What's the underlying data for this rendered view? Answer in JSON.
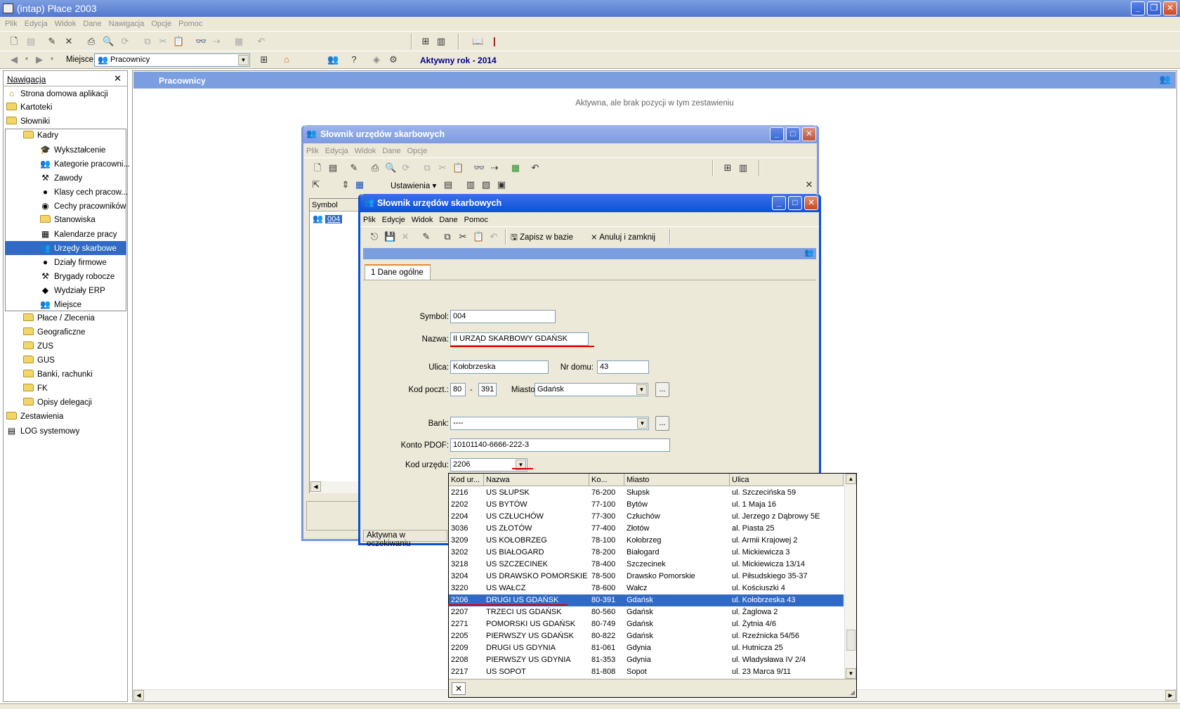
{
  "app": {
    "title": "(intap)  Płace 2003"
  },
  "menu": [
    "Plik",
    "Edycja",
    "Widok",
    "Dane",
    "Nawigacja",
    "Opcje",
    "Pomoc"
  ],
  "toolbar2": {
    "place_label": "Miejsce",
    "place_value": "Pracownicy",
    "active_year": "Aktywny rok - 2014"
  },
  "nav": {
    "header": "Nawigacja",
    "items": [
      {
        "label": "Strona domowa aplikacji",
        "icon": "home-icon"
      },
      {
        "label": "Kartoteki",
        "icon": "folder-icon"
      },
      {
        "label": "Słowniki",
        "icon": "folder-icon"
      },
      {
        "label": "Kadry",
        "icon": "folder-icon"
      },
      {
        "label": "Wykształcenie",
        "icon": "graduate-icon"
      },
      {
        "label": "Kategorie pracowni...",
        "icon": "people-icon"
      },
      {
        "label": "Zawody",
        "icon": "profession-icon"
      },
      {
        "label": "Klasy cech pracow...",
        "icon": "class-icon"
      },
      {
        "label": "Cechy pracowników",
        "icon": "globe-icon"
      },
      {
        "label": "Stanowiska",
        "icon": "folder-icon"
      },
      {
        "label": "Kalendarze pracy",
        "icon": "calendar-icon"
      },
      {
        "label": "Urzędy skarbowe",
        "icon": "tax-office-icon"
      },
      {
        "label": "Działy firmowe",
        "icon": "department-icon"
      },
      {
        "label": "Brygady robocze",
        "icon": "worker-icon"
      },
      {
        "label": "Wydziały ERP",
        "icon": "erp-icon"
      },
      {
        "label": "Miejsce",
        "icon": "place-icon"
      },
      {
        "label": "Płace / Zlecenia",
        "icon": "folder-icon"
      },
      {
        "label": "Geograficzne",
        "icon": "folder-icon"
      },
      {
        "label": "ZUS",
        "icon": "folder-icon"
      },
      {
        "label": "GUS",
        "icon": "folder-icon"
      },
      {
        "label": "Banki, rachunki",
        "icon": "folder-icon"
      },
      {
        "label": "FK",
        "icon": "folder-icon"
      },
      {
        "label": "Opisy delegacji",
        "icon": "folder-icon"
      },
      {
        "label": "Zestawienia",
        "icon": "folder-icon"
      },
      {
        "label": "LOG systemowy",
        "icon": "log-icon"
      }
    ]
  },
  "main": {
    "title": "Pracownicy",
    "empty_message": "Aktywna, ale brak pozycji w tym zestawieniu"
  },
  "list_window": {
    "title": "Słownik urzędów skarbowych",
    "menu": [
      "Plik",
      "Edycja",
      "Widok",
      "Dane",
      "Opcje"
    ],
    "settings_label": "Ustawienia",
    "column": "Symbol",
    "row_value": "004"
  },
  "edit_window": {
    "title": "Słownik urzędów skarbowych",
    "menu": [
      "Plik",
      "Edycje",
      "Widok",
      "Dane",
      "Pomoc"
    ],
    "save_label": "Zapisz w bazie",
    "cancel_label": "Anuluj i zamknij",
    "tab": "1 Dane ogólne",
    "status": "Aktywna w oczekiwaniu",
    "fields": {
      "symbol_label": "Symbol:",
      "symbol": "004",
      "name_label": "Nazwa:",
      "name": "II  URZĄD SKARBOWY GDAŃSK",
      "street_label": "Ulica:",
      "street": "Kołobrzeska",
      "house_label": "Nr domu:",
      "house": "43",
      "postal_label": "Kod poczt.:",
      "postal1": "80",
      "postal_dash": "-",
      "postal2": "391",
      "city_label": "Miasto:",
      "city": "Gdańsk",
      "bank_label": "Bank:",
      "bank": "----",
      "account_label": "Konto PDOF:",
      "account": "10101140-6666-222-3",
      "office_label": "Kod urzędu:",
      "office": "2206",
      "ellipsis": "..."
    }
  },
  "dropdown": {
    "columns": [
      "Kod ur...",
      "Nazwa",
      "Ko...",
      "Miasto",
      "Ulica"
    ],
    "rows": [
      [
        "2216",
        "US SŁUPSK",
        "76-200",
        "Słupsk",
        "ul. Szczecińska 59"
      ],
      [
        "2202",
        "US BYTÓW",
        "77-100",
        "Bytów",
        "ul. 1 Maja 16"
      ],
      [
        "2204",
        "US CZŁUCHÓW",
        "77-300",
        "Człuchów",
        "ul. Jerzego z Dąbrowy 5E"
      ],
      [
        "3036",
        "US ZŁOTÓW",
        "77-400",
        "Złotów",
        "al. Piasta 25"
      ],
      [
        "3209",
        "US KOŁOBRZEG",
        "78-100",
        "Kołobrzeg",
        "ul. Armii Krajowej 2"
      ],
      [
        "3202",
        "US BIAŁOGARD",
        "78-200",
        "Białogard",
        "ul. Mickiewicza 3"
      ],
      [
        "3218",
        "US SZCZECINEK",
        "78-400",
        "Szczecinek",
        "ul. Mickiewicza 13/14"
      ],
      [
        "3204",
        "US DRAWSKO POMORSKIE",
        "78-500",
        "Drawsko Pomorskie",
        "ul. Piłsudskiego 35-37"
      ],
      [
        "3220",
        "US WAŁCZ",
        "78-600",
        "Wałcz",
        "ul. Kościuszki 4"
      ],
      [
        "2206",
        "DRUGI US GDAŃSK",
        "80-391",
        "Gdańsk",
        "ul. Kołobrzeska 43"
      ],
      [
        "2207",
        "TRZECI US GDAŃSK",
        "80-560",
        "Gdańsk",
        "ul. Żaglowa 2"
      ],
      [
        "2271",
        "POMORSKI US GDAŃSK",
        "80-749",
        "Gdańsk",
        "ul. Żytnia 4/6"
      ],
      [
        "2205",
        "PIERWSZY US GDAŃSK",
        "80-822",
        "Gdańsk",
        "ul. Rzeźnicka 54/56"
      ],
      [
        "2209",
        "DRUGI US GDYNIA",
        "81-061",
        "Gdynia",
        "ul. Hutnicza 25"
      ],
      [
        "2208",
        "PIERWSZY US GDYNIA",
        "81-353",
        "Gdynia",
        "ul. Władysława IV 2/4"
      ],
      [
        "2217",
        "US SOPOT",
        "81-808",
        "Sopot",
        "ul. 23 Marca 9/11"
      ]
    ],
    "selected_index": 9
  },
  "colors": {
    "title_active": "#0b52d8",
    "selection": "#316ac5",
    "panel_header": "#7b9ee0",
    "underline": "#e00000"
  }
}
